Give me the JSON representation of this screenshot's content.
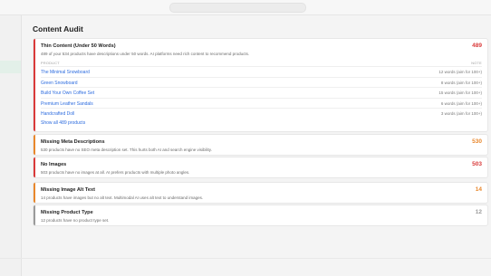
{
  "page": {
    "title": "Content Audit"
  },
  "colors": {
    "critical": "#d93a3a",
    "warning": "#e8872c",
    "neutral": "#9a9a9a",
    "link": "#2d6cdf"
  },
  "cards": {
    "thin": {
      "title": "Thin Content (Under 50 Words)",
      "count": "489",
      "description": "489 of your 534 products have descriptions under 50 words. AI platforms need rich content to recommend products.",
      "table_headers": {
        "product": "PRODUCT",
        "note": "NOTE"
      },
      "rows": [
        {
          "name": "The Minimal Snowboard",
          "note": "12 words (aim for 100+)"
        },
        {
          "name": "Green Snowboard",
          "note": "8 words (aim for 100+)"
        },
        {
          "name": "Build Your Own Coffee Set",
          "note": "15 words (aim for 100+)"
        },
        {
          "name": "Premium Leather Sandals",
          "note": "6 words (aim for 100+)"
        },
        {
          "name": "Handcrafted Doll",
          "note": "3 words (aim for 100+)"
        }
      ],
      "show_all": "Show all 489 products"
    },
    "meta": {
      "title": "Missing Meta Descriptions",
      "count": "530",
      "description": "530 products have no SEO meta description set. This hurts both AI and search engine visibility."
    },
    "images": {
      "title": "No Images",
      "count": "503",
      "description": "503 products have no images at all. AI prefers products with multiple photo angles."
    },
    "alt": {
      "title": "Missing Image Alt Text",
      "count": "14",
      "description": "14 products have images but no alt text. Multimodal AI uses alt text to understand images."
    },
    "type": {
      "title": "Missing Product Type",
      "count": "12",
      "description": "12 products have no product type set."
    }
  }
}
